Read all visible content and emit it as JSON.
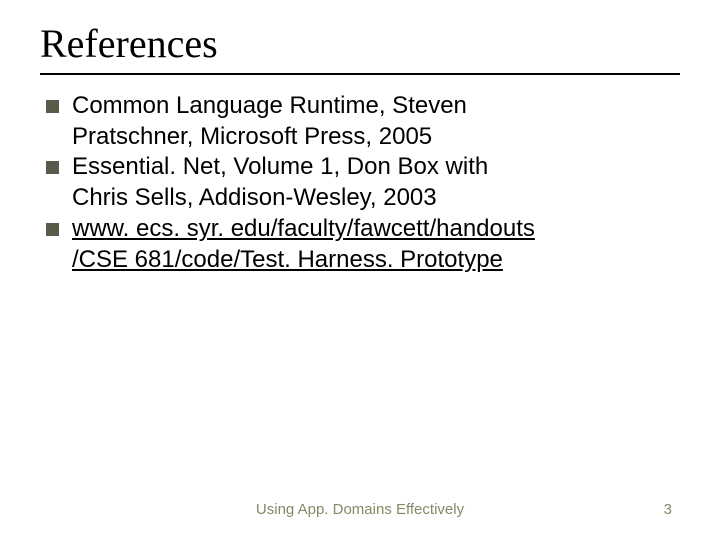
{
  "title": "References",
  "items": [
    {
      "line1": "Common Language Runtime, Steven",
      "line2": "Pratschner, Microsoft Press, 2005"
    },
    {
      "line1": "Essential. Net, Volume 1, Don Box with",
      "line2": "Chris Sells, Addison-Wesley, 2003"
    },
    {
      "link1": "www. ecs. syr. edu/faculty/fawcett/handouts",
      "link2": "/CSE 681/code/Test. Harness. Prototype"
    }
  ],
  "footer": "Using App. Domains Effectively",
  "page": "3"
}
